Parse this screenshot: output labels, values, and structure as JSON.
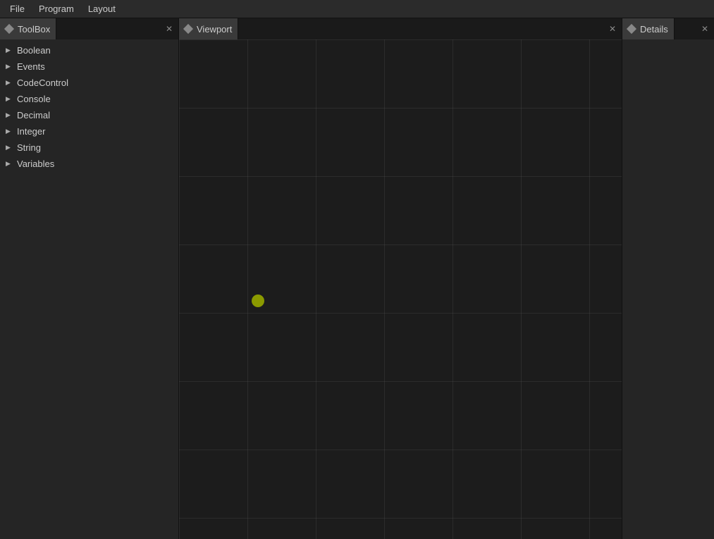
{
  "menubar": {
    "items": [
      {
        "label": "File"
      },
      {
        "label": "Program"
      },
      {
        "label": "Layout"
      }
    ]
  },
  "toolbox": {
    "tab_label": "ToolBox",
    "tab_icon": "diamond",
    "items": [
      {
        "label": "Boolean"
      },
      {
        "label": "Events"
      },
      {
        "label": "CodeControl"
      },
      {
        "label": "Console"
      },
      {
        "label": "Decimal"
      },
      {
        "label": "Integer"
      },
      {
        "label": "String"
      },
      {
        "label": "Variables"
      }
    ],
    "arrow": "▶",
    "close": "✕"
  },
  "viewport": {
    "tab_label": "Viewport",
    "tab_icon": "diamond",
    "close": "✕"
  },
  "details": {
    "tab_label": "Details",
    "tab_icon": "diamond",
    "close": "✕"
  },
  "colors": {
    "active_tab_bg": "#3a3a3a",
    "panel_bg": "#252525",
    "menubar_bg": "#2b2b2b",
    "cursor_color": "#8b9a00"
  }
}
